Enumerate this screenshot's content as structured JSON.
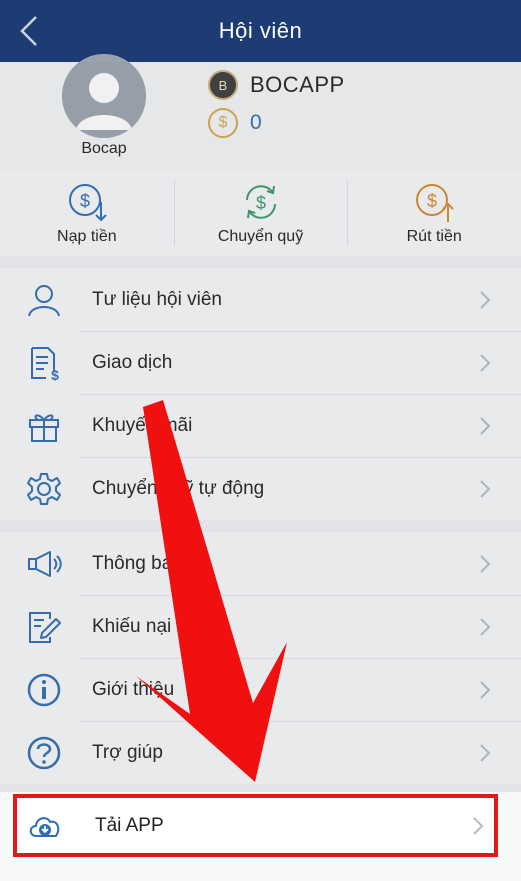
{
  "header": {
    "title": "Hội viên"
  },
  "profile": {
    "avatar_name": "Bocap",
    "account_badge": "B",
    "account_name": "BOCAPP",
    "currency_icon": "$",
    "balance": "0"
  },
  "actions": [
    {
      "label": "Nạp tiền",
      "icon": "deposit-icon"
    },
    {
      "label": "Chuyển quỹ",
      "icon": "transfer-icon"
    },
    {
      "label": "Rút tiền",
      "icon": "withdraw-icon"
    }
  ],
  "menu_group_1": [
    {
      "label": "Tư liệu hội viên",
      "icon": "user-icon"
    },
    {
      "label": "Giao dịch",
      "icon": "transaction-icon"
    },
    {
      "label": "Khuyến mãi",
      "icon": "gift-icon"
    },
    {
      "label": "Chuyển quỹ tự động",
      "icon": "gear-icon"
    }
  ],
  "menu_group_2": [
    {
      "label": "Thông báo",
      "icon": "megaphone-icon"
    },
    {
      "label": "Khiếu nại",
      "icon": "complaint-icon"
    },
    {
      "label": "Giới thiệu",
      "icon": "info-icon"
    },
    {
      "label": "Trợ giúp",
      "icon": "help-icon"
    }
  ],
  "menu_group_3": [
    {
      "label": "Tải APP",
      "icon": "cloud-download-icon"
    }
  ],
  "colors": {
    "header_bg": "#1e3c74",
    "icon_blue": "#2f6db5",
    "icon_green": "#3a9a6a",
    "icon_orange": "#d98a2b",
    "highlight_red": "#e01818"
  }
}
